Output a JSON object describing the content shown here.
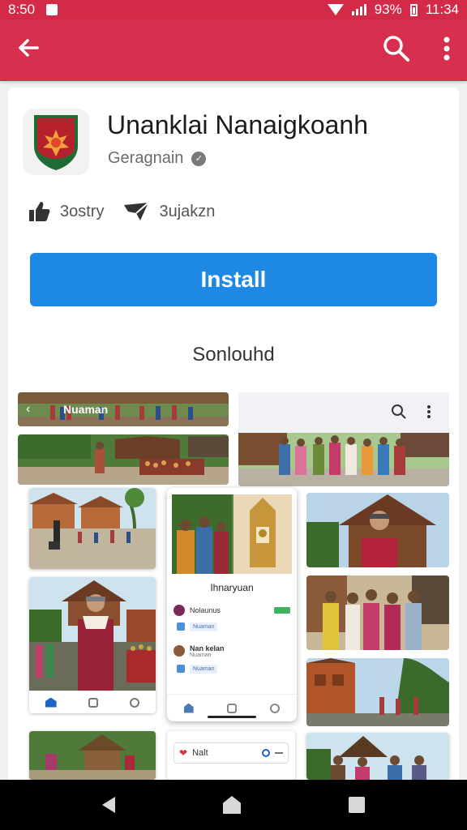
{
  "status": {
    "time_left": "8:50",
    "battery": "93%",
    "clock": "11:34"
  },
  "appbar": {
    "back_icon": "arrow-left-icon",
    "search_icon": "search-icon",
    "menu_icon": "more-vert-icon",
    "color": "#d72f4e"
  },
  "app": {
    "title": "Unanklai Nanaigkoanh",
    "developer": "Geragnain",
    "stat1": "3ostry",
    "stat2": "3ujakzn",
    "install_label": "Install",
    "install_color": "#1e88e5"
  },
  "screenshots": {
    "heading": "Sonlouhd",
    "top_left_label": "Nuaman",
    "phone_title": "Ihnaryuan",
    "phone_row1": "Nolaunus",
    "phone_row1_chip": "Nuaman",
    "phone_row2_title": "Nan kelan",
    "phone_row2_sub": "Nuaman",
    "phone_row2_chip": "Nuaman",
    "bottom_card_label": "Nalt"
  }
}
